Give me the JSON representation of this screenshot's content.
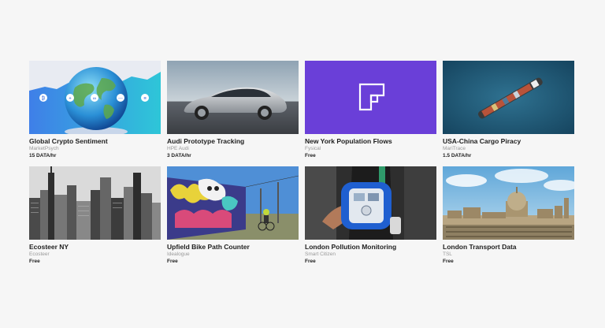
{
  "products": [
    {
      "title": "Global Crypto Sentiment",
      "provider": "MarketPsych",
      "price": "15 DATA/hr",
      "image": "globe-crypto-image"
    },
    {
      "title": "Audi Prototype Tracking",
      "provider": "HPE Audi",
      "price": "3 DATA/hr",
      "image": "car-image"
    },
    {
      "title": "New York Population Flows",
      "provider": "Fysical",
      "price": "Free",
      "image": "fysical-logo-image"
    },
    {
      "title": "USA-China Cargo Piracy",
      "provider": "MariTrace",
      "price": "1.5 DATA/hr",
      "image": "cargo-ship-image"
    },
    {
      "title": "Ecosteer NY",
      "provider": "Ecosteer",
      "price": "Free",
      "image": "new-york-skyline-image"
    },
    {
      "title": "Upfield Bike Path Counter",
      "provider": "Idealogue",
      "price": "Free",
      "image": "graffiti-bike-path-image"
    },
    {
      "title": "London Pollution Monitoring",
      "provider": "Smart Citizen",
      "price": "Free",
      "image": "pollution-sensor-image"
    },
    {
      "title": "London Transport Data",
      "provider": "TSL",
      "price": "Free",
      "image": "london-skyline-image"
    }
  ],
  "colors": {
    "fysical_purple": "#6a3fd8",
    "crypto_blue": "#2c5fd6",
    "ocean": "#1f5a7a",
    "page_background": "#f6f6f6"
  }
}
